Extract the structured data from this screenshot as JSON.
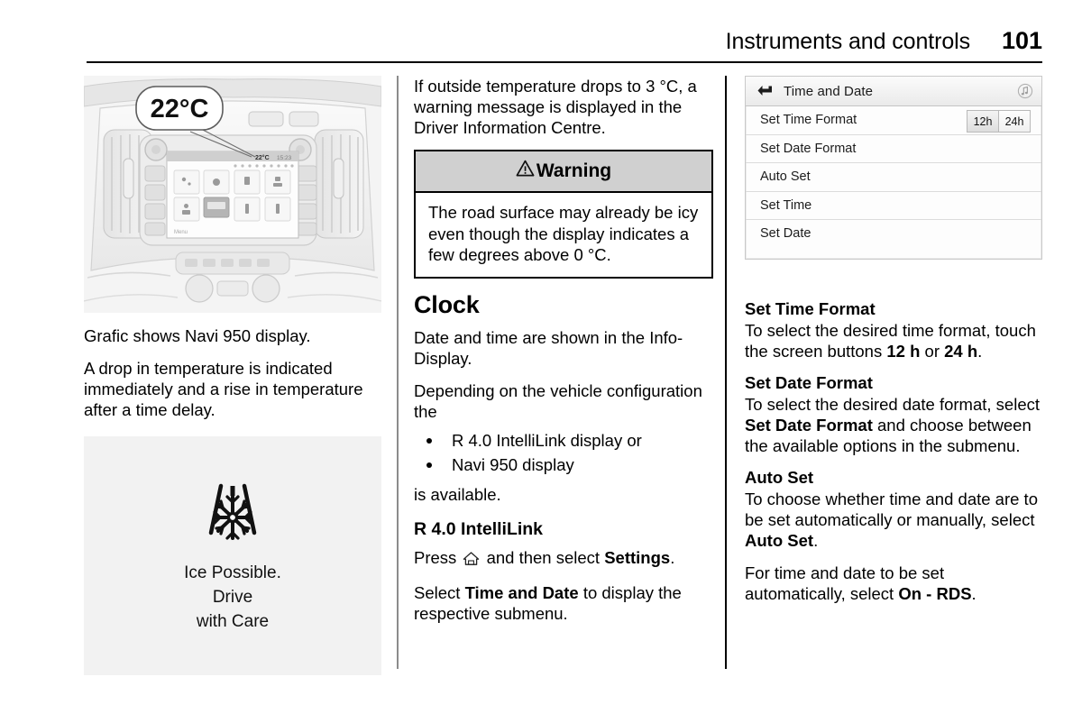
{
  "header": {
    "chapter": "Instruments and controls",
    "page_number": "101"
  },
  "column_1": {
    "figure": {
      "name": "navi-950-dashboard-illustration",
      "callout_value": "22°C",
      "screen_status_temp": "22°C",
      "screen_status_time": "15:23",
      "screen_menu_label": "Menu"
    },
    "caption": "Grafic shows Navi 950 display.",
    "paragraph": "A drop in temperature is indicated immediately and a rise in temperature after a time delay.",
    "ice_display": {
      "icon": "ice-warning-snowflake-icon",
      "line_1": "Ice Possible.",
      "line_2": "Drive",
      "line_3": "with Care"
    }
  },
  "column_2": {
    "intro": "If outside temperature drops to 3 °C, a warning message is displayed in the Driver Information Centre.",
    "warning": {
      "label": "Warning",
      "body": "The road surface may already be icy even though the display indicates a few degrees above 0 °C."
    },
    "clock_heading": "Clock",
    "clock_p1": "Date and time are shown in the Info-Display.",
    "clock_p2": "Depending on the vehicle configuration the",
    "bullets": [
      "R 4.0 IntelliLink display or",
      "Navi 950 display"
    ],
    "clock_p3": "is available.",
    "intellilink_heading": "R 4.0 IntelliLink",
    "press_prefix": "Press",
    "press_middle": "and then select",
    "press_bold": "Settings",
    "press_suffix": ".",
    "select_prefix": "Select",
    "select_bold": "Time and Date",
    "select_suffix": "to display the respective submenu."
  },
  "column_3": {
    "panel": {
      "back_icon": "back-arrow-icon",
      "title": "Time and Date",
      "music_icon": "music-note-icon",
      "rows": [
        {
          "label": "Set Time Format",
          "toggle": [
            "12h",
            "24h"
          ],
          "selected": "12h"
        },
        {
          "label": "Set Date Format"
        },
        {
          "label": "Auto Set"
        },
        {
          "label": "Set Time"
        },
        {
          "label": "Set Date"
        }
      ]
    },
    "sections": [
      {
        "heading": "Set Time Format",
        "text_prefix": "To select the desired time format, touch the screen buttons",
        "bold_1": "12 h",
        "text_middle": "or",
        "bold_2": "24 h",
        "text_suffix": "."
      },
      {
        "heading": "Set Date Format",
        "text_prefix": "To select the desired date format, select",
        "bold_1": "Set Date Format",
        "text_suffix": "and choose between the available options in the submenu."
      },
      {
        "heading": "Auto Set",
        "text_prefix": "To choose whether time and date are to be set automatically or manually, select",
        "bold_1": "Auto Set",
        "text_suffix": "."
      }
    ],
    "closing_prefix": "For time and date to be set automatically, select",
    "closing_bold": "On - RDS",
    "closing_suffix": "."
  },
  "colors": {
    "warning_header_bg": "#d0d0d0",
    "figure_bg": "#f2f2f2",
    "rule": "#000000",
    "divider": "#8c8c8c"
  }
}
